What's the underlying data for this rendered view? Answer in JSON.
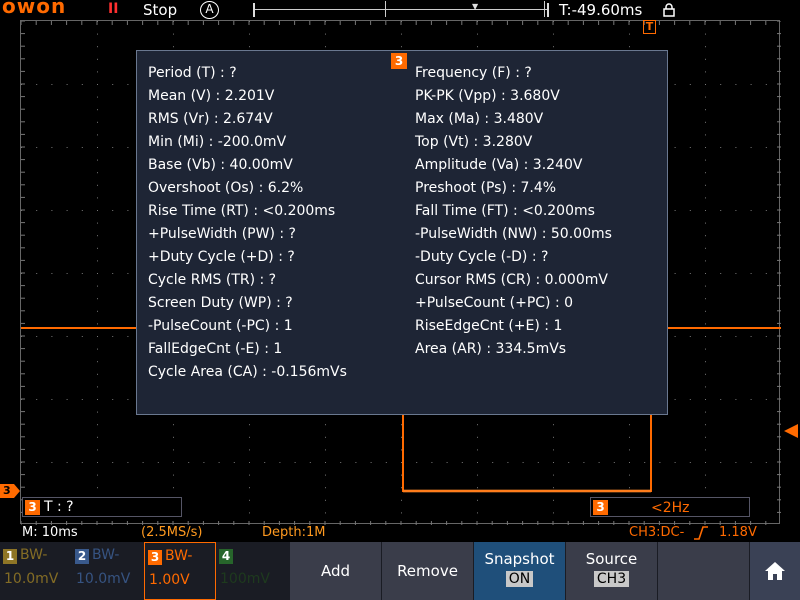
{
  "brand": {
    "logo": "OWON"
  },
  "topbar": {
    "run_icon": "II",
    "run_state": "Stop",
    "acquire_icon": "A",
    "trigger_time": "T:-49.60ms"
  },
  "measurements": {
    "channel_badge": "3",
    "left": [
      "Period (T) :   ?",
      "Mean (V) : 2.201V",
      "RMS (Vr) : 2.674V",
      "Min (Mi) : -200.0mV",
      "Base (Vb) : 40.00mV",
      "Overshoot (Os) : 6.2%",
      "Rise Time (RT) : <0.200ms",
      "+PulseWidth (PW) :   ?",
      "+Duty Cycle (+D) :   ?",
      "Cycle RMS (TR) :   ?",
      "Screen Duty (WP) :   ?",
      "-PulseCount (-PC) : 1",
      "FallEdgeCnt (-E) : 1",
      "Cycle Area (CA) : -0.156mVs"
    ],
    "right": [
      "Frequency (F) :   ?",
      "PK-PK (Vpp) : 3.680V",
      "Max (Ma) : 3.480V",
      "Top (Vt) : 3.280V",
      "Amplitude (Va) : 3.240V",
      "Preshoot (Ps) : 7.4%",
      "Fall Time (FT) : <0.200ms",
      "-PulseWidth (NW) : 50.00ms",
      "-Duty Cycle (-D) :   ?",
      "Cursor RMS (CR) : 0.000mV",
      "+PulseCount (+PC) : 0",
      "RiseEdgeCnt (+E) : 1",
      "Area (AR) : 334.5mVs"
    ]
  },
  "screen_fields": {
    "left_badge": "3",
    "period_text": "T :   ?",
    "right_badge": "3",
    "freq_text": "<2Hz",
    "ch_marker": "3",
    "trigger_marker": "T"
  },
  "status": {
    "timebase": "M: 10ms",
    "sample_rate": "(2.5MS/s)",
    "depth": "Depth:1M",
    "trigger_info": "CH3:DC-",
    "trigger_level": "1.18V"
  },
  "channels": [
    {
      "num": "1",
      "bw": "BW-",
      "scale": "10.0mV",
      "color": "#c9a227"
    },
    {
      "num": "2",
      "bw": "BW-",
      "scale": "10.0mV",
      "color": "#4a78c0"
    },
    {
      "num": "3",
      "bw": "BW-",
      "scale": "1.00V",
      "color": "#ff6a00"
    },
    {
      "num": "4",
      "bw": "",
      "scale": "100mV",
      "color": "#2f8a2f"
    }
  ],
  "softkeys": {
    "add": "Add",
    "remove": "Remove",
    "snapshot": {
      "label": "Snapshot",
      "value": "ON"
    },
    "source": {
      "label": "Source",
      "value": "CH3"
    },
    "home_icon": "home-icon"
  },
  "colors": {
    "ch3": "#ff6a00",
    "panel_bg": "#1e2535",
    "softkey_bg": "#3a3d4a",
    "snapshot_bg": "#1f4f7a"
  }
}
